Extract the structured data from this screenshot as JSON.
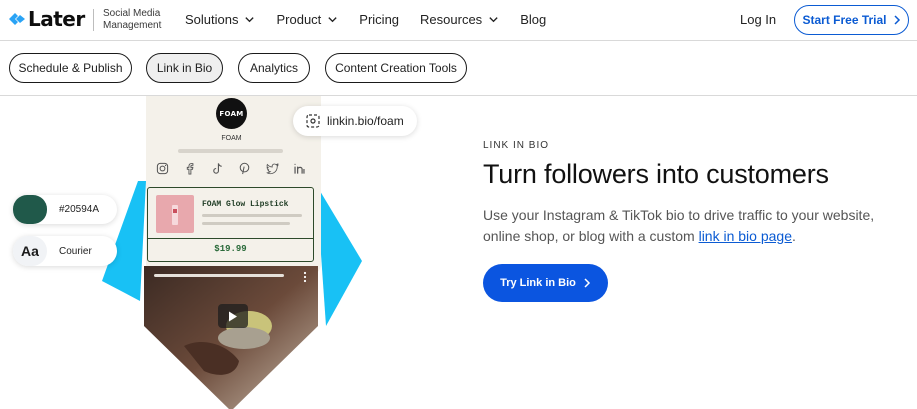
{
  "header": {
    "brand": "Later",
    "tagline": "Social Media Management",
    "nav": [
      {
        "label": "Solutions",
        "has_dropdown": true
      },
      {
        "label": "Product",
        "has_dropdown": true
      },
      {
        "label": "Pricing",
        "has_dropdown": false
      },
      {
        "label": "Resources",
        "has_dropdown": true
      },
      {
        "label": "Blog",
        "has_dropdown": false
      }
    ],
    "login_label": "Log In",
    "trial_label": "Start Free Trial"
  },
  "subnav": {
    "tabs": [
      {
        "label": "Schedule & Publish",
        "active": false
      },
      {
        "label": "Link in Bio",
        "active": true
      },
      {
        "label": "Analytics",
        "active": false
      },
      {
        "label": "Content Creation Tools",
        "active": false
      }
    ]
  },
  "mockup": {
    "avatar_text": "FOAM",
    "handle": "FOAM",
    "url": "linkin.bio/foam",
    "social_icons": [
      "instagram-icon",
      "facebook-icon",
      "tiktok-icon",
      "pinterest-icon",
      "twitter-icon",
      "linkedin-icon"
    ],
    "product_name": "FOAM Glow Lipstick",
    "product_price": "$19.99",
    "color_hex": "#20594A",
    "font_sample": "Aa",
    "font_name": "Courier"
  },
  "hero": {
    "eyebrow": "LINK IN BIO",
    "headline": "Turn followers into customers",
    "description": "Use your Instagram & TikTok bio to drive traffic to your website, online shop, or blog with a custom ",
    "description_link": "link in bio page",
    "description_end": ".",
    "cta_label": "Try Link in Bio"
  },
  "colors": {
    "accent_blue": "#0b55e0",
    "hero_cyan": "#18c1f5",
    "brand_green": "#20594A"
  }
}
